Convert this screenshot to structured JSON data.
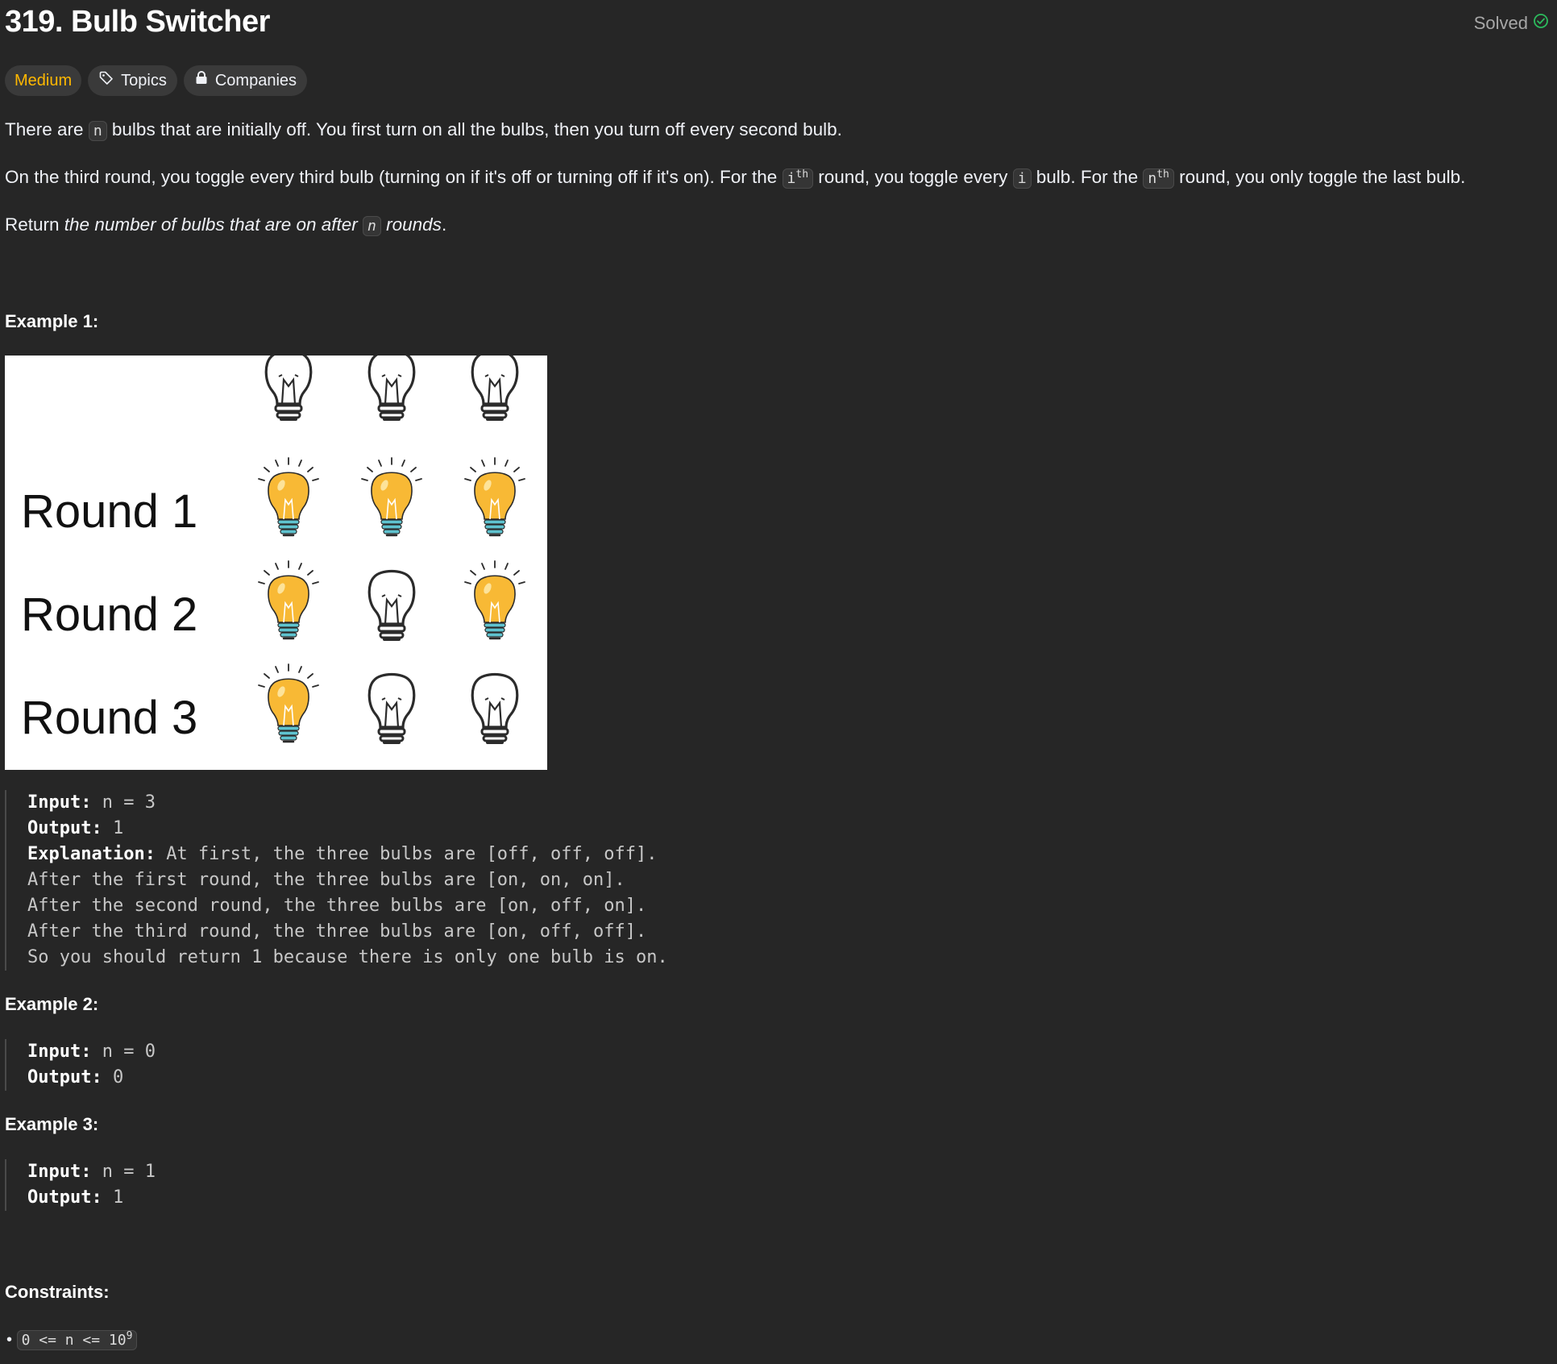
{
  "problem": {
    "title": "319. Bulb Switcher",
    "status": "Solved",
    "tags": {
      "difficulty": "Medium",
      "topics": "Topics",
      "companies": "Companies"
    }
  },
  "description": {
    "p1": {
      "a": "There are ",
      "code": "n",
      "b": " bulbs that are initially off. You first turn on all the bulbs, then you turn off every second bulb."
    },
    "p2": {
      "a": "On the third round, you toggle every third bulb (turning on if it's off or turning off if it's on). For the ",
      "c1": "i",
      "c1sup": "th",
      "b": " round, you toggle every ",
      "c2": "i",
      "c": " bulb. For the ",
      "c3": "n",
      "c3sup": "th",
      "d": " round, you only toggle the last bulb."
    },
    "p3": {
      "a": "Return ",
      "b": "the number of bulbs that are on after ",
      "code": "n",
      "c": " rounds",
      "d": "."
    }
  },
  "examples": [
    {
      "heading": "Example 1:",
      "figure": {
        "round_labels": [
          "Round 1",
          "Round 2",
          "Round 3"
        ],
        "states": [
          [
            false,
            false,
            false
          ],
          [
            true,
            true,
            true
          ],
          [
            true,
            false,
            true
          ],
          [
            true,
            false,
            false
          ]
        ]
      },
      "input_label": "Input:",
      "input": " n = 3",
      "output_label": "Output:",
      "output": " 1",
      "explanation_label": "Explanation:",
      "explanation_lines": [
        " At first, the three bulbs are [off, off, off].",
        "After the first round, the three bulbs are [on, on, on].",
        "After the second round, the three bulbs are [on, off, on].",
        "After the third round, the three bulbs are [on, off, off].",
        "So you should return 1 because there is only one bulb is on."
      ]
    },
    {
      "heading": "Example 2:",
      "input_label": "Input:",
      "input": " n = 0",
      "output_label": "Output:",
      "output": " 0"
    },
    {
      "heading": "Example 3:",
      "input_label": "Input:",
      "input": " n = 1",
      "output_label": "Output:",
      "output": " 1"
    }
  ],
  "constraints": {
    "heading": "Constraints:",
    "items": [
      {
        "text": "0 <= n <= 10",
        "sup": "9"
      }
    ]
  },
  "colors": {
    "difficulty_medium": "#ffb800",
    "solved_check": "#2cbb5d",
    "background": "#262626"
  }
}
